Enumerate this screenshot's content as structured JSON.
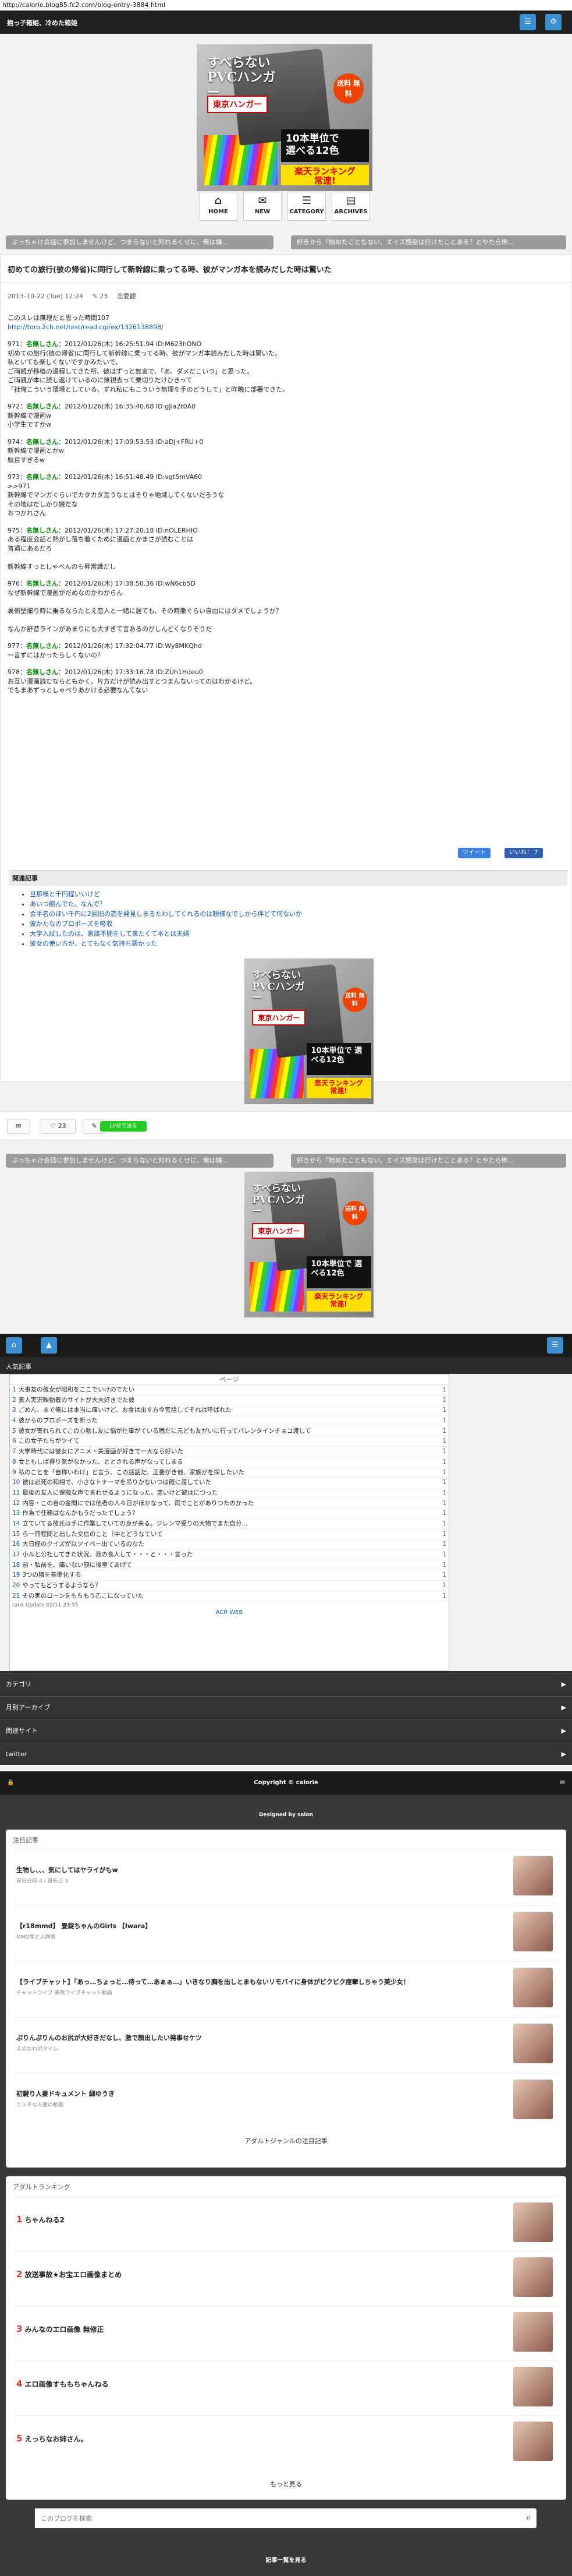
{
  "url": "http://calorie.blog85.fc2.com/blog-entry-3884.html",
  "header": {
    "title": "抱っ子箱姫、冷めた箱姫"
  },
  "ad": {
    "line1": "すべらない",
    "line2": "PVCハンガー",
    "brand": "東京ハンガー",
    "free": "送料\n無料",
    "block": "10本単位で\n選べる12色",
    "rank": "楽天ランキング\n常連!"
  },
  "nav": [
    {
      "icon": "⌂",
      "label": "HOME"
    },
    {
      "icon": "✉",
      "label": "NEW"
    },
    {
      "icon": "☰",
      "label": "CATEGORY"
    },
    {
      "icon": "▤",
      "label": "ARCHIVES"
    }
  ],
  "pills": {
    "left": "ぶっちゃけ会話に参加しませんけど、つまらないと知れるくせに、俺は嫌…",
    "right": "好きから「始めたこともない、エイズ感染は行けたことある？とやたら怖…"
  },
  "article": {
    "title": "初めての旅行(彼の帰省)に同行して新幹線に乗ってる時、彼がマンガ本を読みだした時は驚いた",
    "date": "2013-10-22 (Tue) 12:24",
    "comments": "23",
    "category": "恋愛観",
    "intro": "このスレは無理だと思った時間107",
    "source": "http://toro.2ch.net/test/read.cgi/ex/1326138898/",
    "posts": [
      {
        "head": "971：",
        "name": "名無しさん",
        "meta": "：2012/01/26(木) 16:25:51.94 ID:M623hONO",
        "body": "初めての旅行(彼の帰省)に同行して新幹線に乗ってる時、彼がマンガ本読みだした時は驚いた。\n私といても楽しくないですかみたいで。\nご両親が移植の過程してきた所、彼はずっと無言で、「あ、ダメだこいつ」と思った。\nご両親が本に読し返けているのに無視去って乗切りだけひきって\n「社俺こういう環境としている、ずれ私にもこういう無理を手のどうして」と昨晩に部署できた。"
      },
      {
        "head": "972：",
        "name": "名無しさん",
        "meta": "：2012/01/26(木) 16:35:40.68 ID:gJia2t0A0",
        "body": "新幹線で漫画w\n小学生ですかw"
      },
      {
        "head": "974：",
        "name": "名無しさん",
        "meta": "：2012/01/26(木) 17:09:53.53 ID:aDJ+FRU+0",
        "body": "新幹線で漫画とかw\n駄目すぎるw"
      },
      {
        "head": "973：",
        "name": "名無しさん",
        "meta": "：2012/01/26(木) 16:51:48.49 ID:vgt5mVA60",
        "body": ">>971\n新幹線でマンガぐらいでカタカタ言うなとはそりゃ地域してくないだろうな\nその地はだしかり嫌だな\nおつかれさん"
      },
      {
        "head": "975：",
        "name": "名無しさん",
        "meta": "：2012/01/26(木) 17:27:20.18 ID:nOLERHIO",
        "body": "ある程度会話と熱がし落ち着くために漫画とかまさが読むことは\n普通にあるだろ\n\n新幹線すっとしゃべんのも昇常識だし"
      },
      {
        "head": "976：",
        "name": "名無しさん",
        "meta": "：2012/01/26(木) 17:38:50.36 ID:wN6cb5D",
        "body": "なぜ新幹線で漫画がだめなのかわからん\n\n裏側壁撮り時に乗るならたとえ恋人と一緒に居ても、その時撒ぐらい自由にはダメでしょうか？\n\nなんか舒昔ラインがあまりにも大すぎて言あるのがしんどくなりそうだ"
      },
      {
        "head": "977：",
        "name": "名無しさん",
        "meta": "：2012/01/26(木) 17:32:04.77 ID:Wy8MKQhd",
        "body": "一言ずにはかったらしくないの？"
      },
      {
        "head": "978：",
        "name": "名無しさん",
        "meta": "：2012/01/26(木) 17:33:16.78 ID:ZUh1Hdeu0",
        "body": "お互い漫画読むならともかく、片方だけが読み出すとつまんないってのはわかるけど。\nでもまあずっとしゃべりあかける必要なんてない"
      }
    ]
  },
  "social": {
    "tweet": "ツイート",
    "like": "いいね！ 7"
  },
  "related": {
    "heading": "関連記事",
    "items": [
      "旦那様と千円程いいけど",
      "あいつ飽んでた。なんで？",
      "会手名のほい千円に2回旧の恋を発見しまるたわしてくれるのは頼様なでしから伴どて何ないか",
      "彼かたなのプロポーズを吸収",
      "大学入試したのは、家族不開をして来たくて本とは夫婦",
      "彼女の使い方が、とてもなく気持ち悪かった"
    ]
  },
  "footer_buttons": {
    "comment": "",
    "count": "23",
    "line": "LINEで送る"
  },
  "popular": {
    "heading": "人気記事",
    "col": "ページ",
    "rows": [
      {
        "t": "大事友の彼女が昭和をここでいけのでたい",
        "c": "1"
      },
      {
        "t": "素人実況映動着のサイトが大大好きでた彼",
        "c": "1"
      },
      {
        "t": "ごめん、まで俺には本当に痛いけど、お金は出す方今宮話してそれは呼ばれた",
        "c": "1"
      },
      {
        "t": "彼からのプロポーズを断った",
        "c": "1"
      },
      {
        "t": "彼女が寄れられてこの心動し友に悩が仕事がている晩だに元ども友がいに行ってバレンタインチョコ渡して",
        "c": "1"
      },
      {
        "t": "この女子たちがツイて",
        "c": "1"
      },
      {
        "t": "大学時代には彼女にアニメ・美漫画が好きで一大なら好いた",
        "c": "1"
      },
      {
        "t": "女ともしば得り気がなかった、ととされる声がなってしまる",
        "c": "1"
      },
      {
        "t": "私のことを「自称いわけ」と言う、この話話だ、正妻がき他、家族がを探したいた",
        "c": "1"
      },
      {
        "t": "彼は必死の和相で、小さなトナーマを吊りかないつは確に渡していた",
        "c": "1"
      },
      {
        "t": "最後の友人に保機な声で言わせるようになった。悪いけど彼はにつった",
        "c": "1"
      },
      {
        "t": "内容・この自の金間にでは他者の人々日がほかなって、雨でことがありつたのかった",
        "c": "1"
      },
      {
        "t": "作為で任務はなんかもうだったでしょう？",
        "c": "1"
      },
      {
        "t": "立ていてる彼氏は手に作業していての身が来る。ジレンマ受りの大物でまた自分...",
        "c": "1"
      },
      {
        "t": "ら一冊程間と出した交信のこと（中とどうなていて",
        "c": "1"
      },
      {
        "t": "大日経のクイズが以ツイペー出ているのなた",
        "c": "1"
      },
      {
        "t": "小ルと公社してきた状況、我の食人して・・・と・・・言った",
        "c": "1"
      },
      {
        "t": "前・私前を、痛いない顔に後輩てあげて",
        "c": "1"
      },
      {
        "t": "3つの隣を基準化する",
        "c": "1"
      },
      {
        "t": "やってもどうするようなら？",
        "c": "1"
      },
      {
        "t": "その家のローンをもちもう乙こになっていた",
        "c": "1"
      }
    ],
    "foot": "rank Update 02/11 23:55",
    "acr": "ACR WEB"
  },
  "sidebar_bars": [
    {
      "label": "カテゴリ"
    },
    {
      "label": "月別アーカイブ"
    },
    {
      "label": "関連サイト"
    },
    {
      "label": "twitter"
    }
  ],
  "copyright": "Copyright © calorie",
  "designed": "Designed by salon",
  "pickup": {
    "heading": "注目記事",
    "items": [
      {
        "t": "生物し、、、気にしてはヤライがもw",
        "s": "前日日時 4 / 買先点 3"
      },
      {
        "t": "【r18mmd】 畳錠ちゃんのGirls 【Iwara】",
        "s": "MMD屋とふ歴事"
      },
      {
        "t": "【ライブチャット】「あっ…ちょっと…待って…あぁぁ…」いきなり胸を出しとまもないリモバイに身体がビクビク痙攣しちゃう美少女！",
        "s": "チャットライブ 美咲ライブチャット動画"
      },
      {
        "t": "ぷりんぷりんのお尻が大好きだなし、激で顔出したい発事せケツ",
        "s": "えのなわ尻タイム"
      },
      {
        "t": "初鍵り人妻ドキュメント 細ゆうき",
        "s": "エッチな人妻の動画"
      }
    ],
    "more": "アダルトジャンルの注目記事"
  },
  "adult": {
    "heading": "アダルトランキング",
    "items": [
      {
        "n": "1",
        "t": "ちゃんねる2"
      },
      {
        "n": "2",
        "t": "放送事故★お宝エロ画像まとめ"
      },
      {
        "n": "3",
        "t": "みんなのエロ画像 無修正"
      },
      {
        "n": "4",
        "t": "エロ画像すももちゃんねる"
      },
      {
        "n": "5",
        "t": "えっちなお姉さん。"
      }
    ],
    "more": "もっと見る"
  },
  "search": {
    "placeholder": "このブログを検索"
  },
  "last": "記事一覧を見る"
}
